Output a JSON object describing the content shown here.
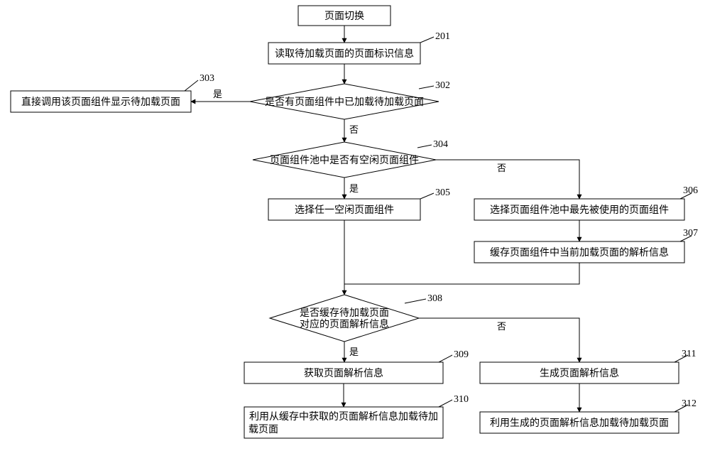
{
  "chart_data": {
    "type": "flowchart",
    "title": "",
    "nodes": {
      "start": {
        "label": "页面切换",
        "num": ""
      },
      "n201": {
        "label": "读取待加载页面的页面标识信息",
        "num": "201"
      },
      "d302": {
        "label": "是否有页面组件中已加载待加载页面",
        "num": "302"
      },
      "n303": {
        "label": "直接调用该页面组件显示待加载页面",
        "num": "303"
      },
      "d304": {
        "label": "页面组件池中是否有空闲页面组件",
        "num": "304"
      },
      "n305": {
        "label": "选择任一空闲页面组件",
        "num": "305"
      },
      "n306": {
        "label": "选择页面组件池中最先被使用的页面组件",
        "num": "306"
      },
      "n307": {
        "label": "缓存页面组件中当前加载页面的解析信息",
        "num": "307"
      },
      "d308": {
        "label1": "是否缓存待加载页面",
        "label2": "对应的页面解析信息",
        "num": "308"
      },
      "n309": {
        "label": "获取页面解析信息",
        "num": "309"
      },
      "n311": {
        "label": "生成页面解析信息",
        "num": "311"
      },
      "n310": {
        "label1": "利用从缓存中获取的页面解析信息加载待加",
        "label2": "载页面",
        "num": "310"
      },
      "n312": {
        "label": "利用生成的页面解析信息加载待加载页面",
        "num": "312"
      }
    },
    "edge_labels": {
      "yes": "是",
      "no": "否"
    }
  }
}
